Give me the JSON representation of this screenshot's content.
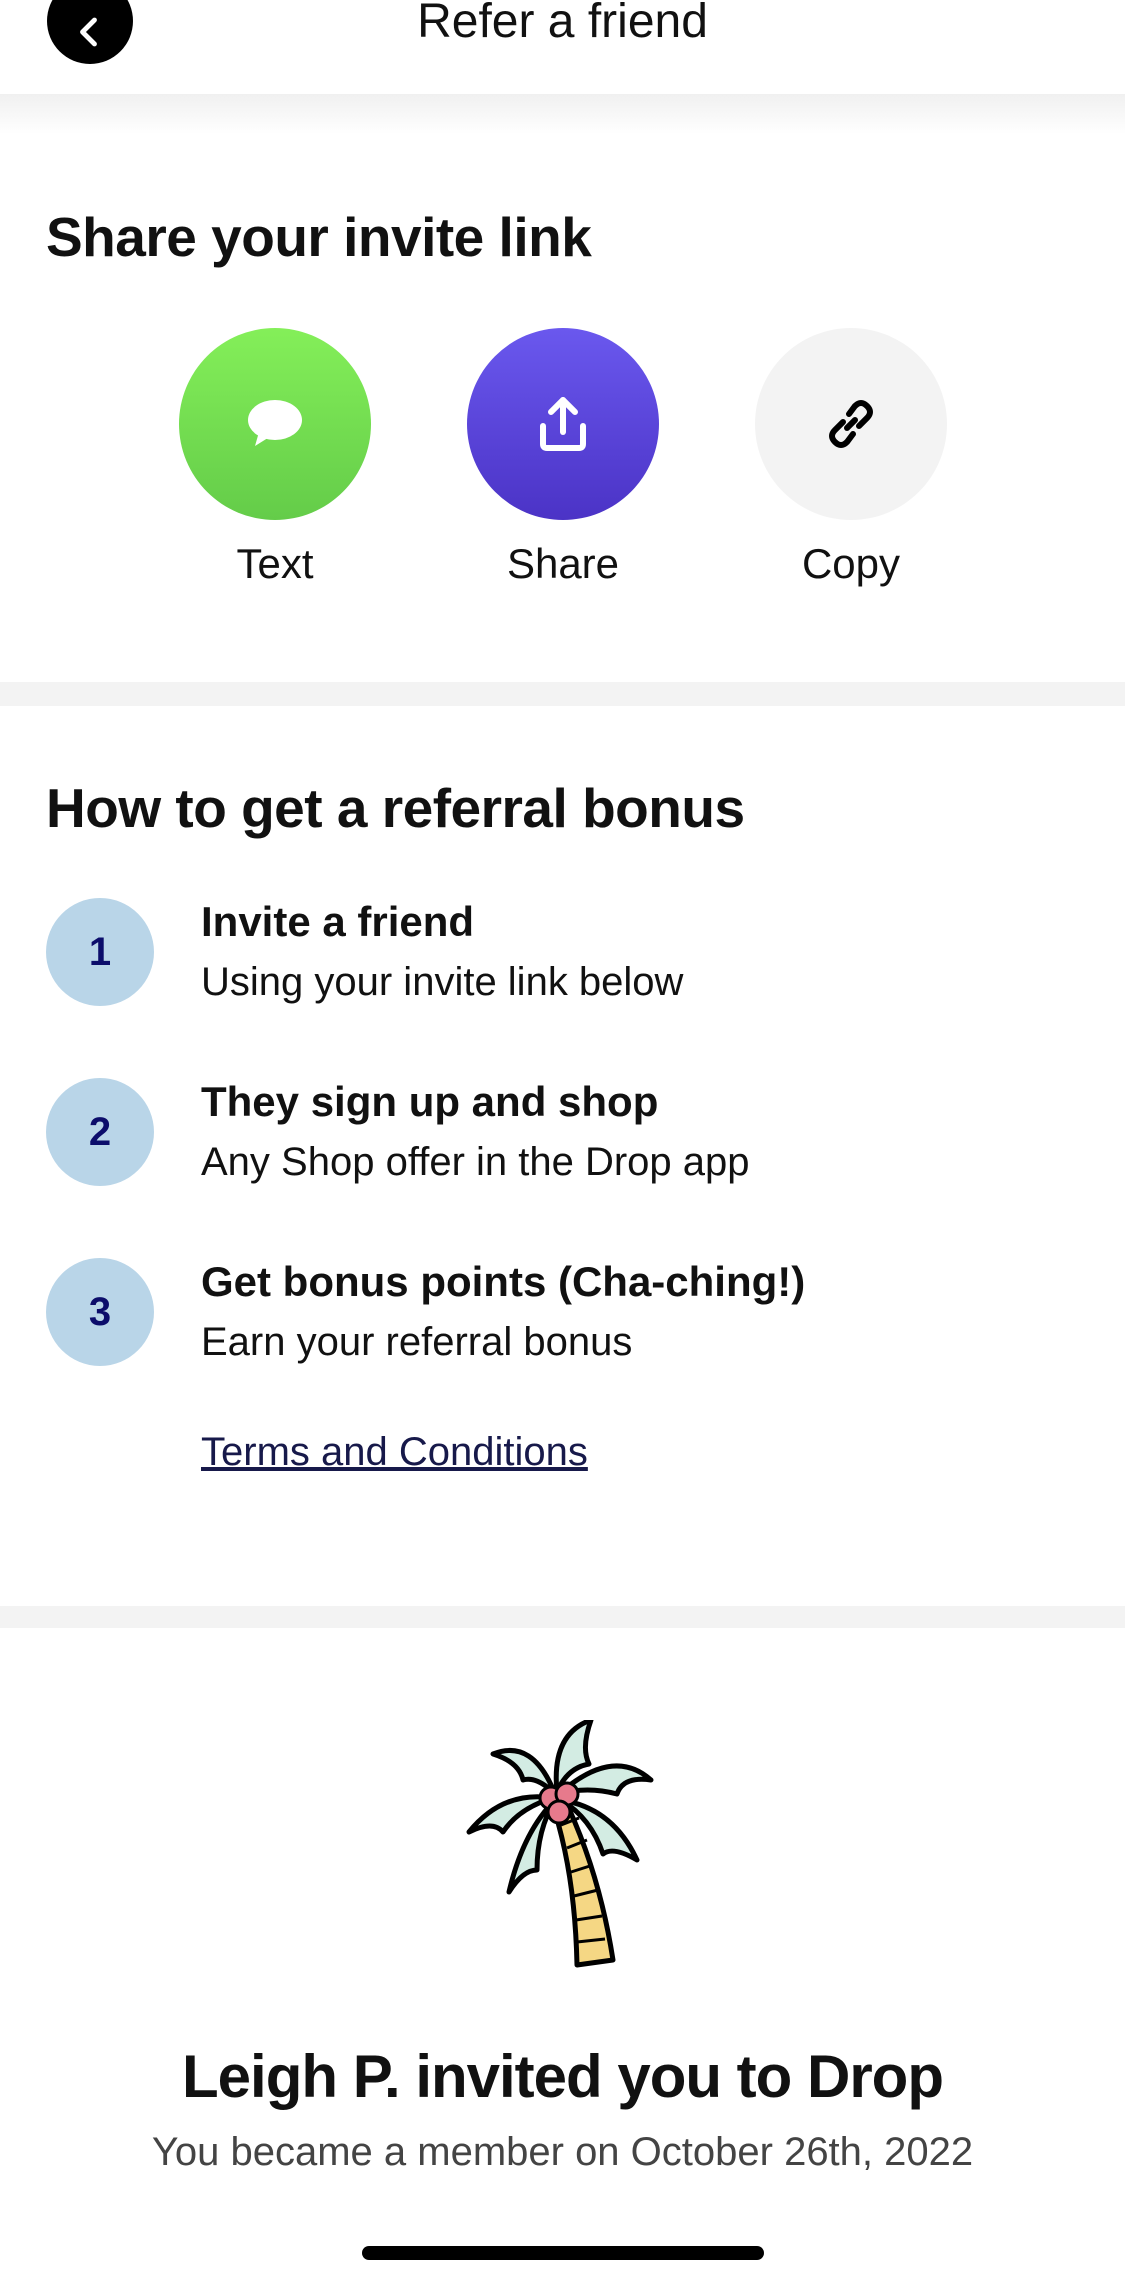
{
  "header": {
    "title": "Refer a friend"
  },
  "share_section": {
    "title": "Share your invite link",
    "options": [
      {
        "label": "Text",
        "icon": "chat-bubble-icon",
        "color": "#6FDC50"
      },
      {
        "label": "Share",
        "icon": "upload-share-icon",
        "color": "#5A45DC"
      },
      {
        "label": "Copy",
        "icon": "link-icon",
        "color": "#F3F3F3"
      }
    ]
  },
  "bonus_section": {
    "title": "How to get a referral bonus",
    "steps": [
      {
        "number": "1",
        "title": "Invite a friend",
        "subtitle": "Using your invite link below"
      },
      {
        "number": "2",
        "title": "They sign up and shop",
        "subtitle": "Any Shop offer in the Drop app"
      },
      {
        "number": "3",
        "title": "Get bonus points (Cha-ching!)",
        "subtitle": "Earn your referral bonus"
      }
    ],
    "terms_link": "Terms and Conditions"
  },
  "inviter": {
    "illustration": "palm-tree-illustration",
    "title": "Leigh P. invited you to Drop",
    "subtitle": "You became a member on October 26th, 2022"
  },
  "colors": {
    "step_badge_bg": "#B9D5E8",
    "step_badge_text": "#0C0D6B",
    "terms_link": "#17194A",
    "divider": "#F3F3F3"
  }
}
